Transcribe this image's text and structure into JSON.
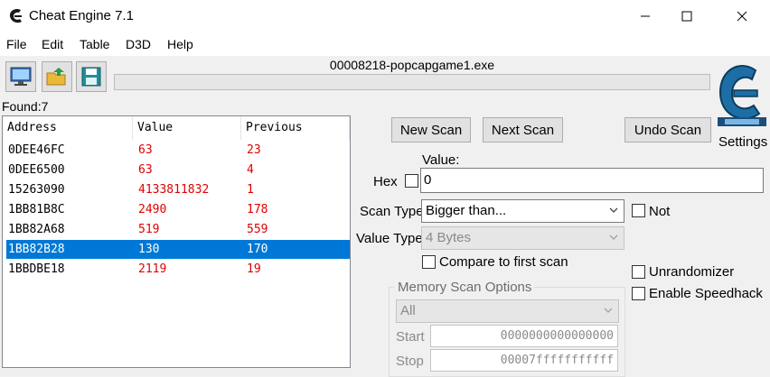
{
  "window": {
    "title": "Cheat Engine 7.1",
    "process": "00008218-popcapgame1.exe",
    "minimize": "—",
    "maximize": "☐",
    "close": "✕"
  },
  "menu": [
    "File",
    "Edit",
    "Table",
    "D3D",
    "Help"
  ],
  "found": "Found:7",
  "list": {
    "columns": [
      "Address",
      "Value",
      "Previous"
    ],
    "rows": [
      {
        "address": "0DEE46FC",
        "value": "63",
        "previous": "23"
      },
      {
        "address": "0DEE6500",
        "value": "63",
        "previous": "4"
      },
      {
        "address": "15263090",
        "value": "4133811832",
        "previous": "1"
      },
      {
        "address": "1BB81B8C",
        "value": "2490",
        "previous": "178"
      },
      {
        "address": "1BB82A68",
        "value": "519",
        "previous": "559"
      },
      {
        "address": "1BB82B28",
        "value": "130",
        "previous": "170"
      },
      {
        "address": "1BBDBE18",
        "value": "2119",
        "previous": "19"
      }
    ],
    "selected_row": 5
  },
  "scan": {
    "new_scan": "New Scan",
    "next_scan": "Next Scan",
    "undo_scan": "Undo Scan",
    "settings": "Settings",
    "value_label": "Value:",
    "hex_label": "Hex",
    "value": "0",
    "scan_type_label": "Scan Type",
    "scan_type": "Bigger than...",
    "value_type_label": "Value Type",
    "value_type": "4 Bytes",
    "not_label": "Not",
    "compare_first": "Compare to first scan",
    "unrandomizer": "Unrandomizer",
    "speedhack": "Enable Speedhack",
    "memory_options": "Memory Scan Options",
    "memory_region": "All",
    "start_label": "Start",
    "start_value": "0000000000000000",
    "stop_label": "Stop",
    "stop_value": "00007fffffffffff"
  },
  "colors": {
    "accent": "#0078d7",
    "value_red": "#e00000",
    "logo_blue": "#1c6ea4"
  }
}
